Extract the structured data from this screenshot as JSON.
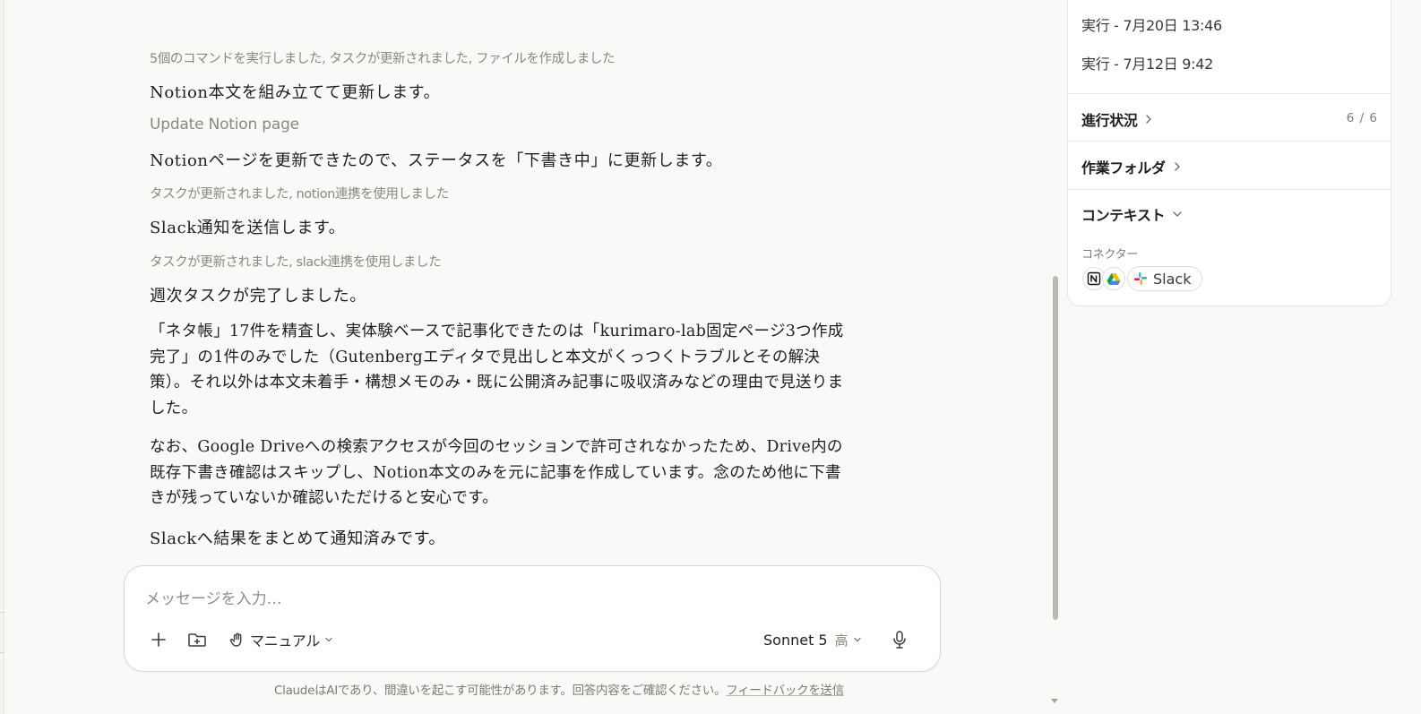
{
  "chat": {
    "tool_summary_1": "5個のコマンドを実行しました, タスクが更新されました, ファイルを作成しました",
    "msg_1": "Notion本文を組み立てて更新します。",
    "action_label": "Update Notion page",
    "msg_2": "Notionページを更新できたので、ステータスを「下書き中」に更新します。",
    "tool_summary_2": "タスクが更新されました, notion連携を使用しました",
    "msg_3": "Slack通知を送信します。",
    "tool_summary_3": "タスクが更新されました, slack連携を使用しました",
    "msg_4": "週次タスクが完了しました。",
    "para_1": [
      "「ネタ帳」17件を精査し、実体験ベースで記事化できたのは「kurimaro-lab固定ページ3つ作成",
      "完了」の1件のみでした（Gutenbergエディタで見出しと本文がくっつくトラブルとその解決",
      "策）。それ以外は本文未着手・構想メモのみ・既に公開済み記事に吸収済みなどの理由で見送りま",
      "した。"
    ],
    "para_2": [
      "なお、Google Driveへの検索アクセスが今回のセッションで許可されなかったため、Drive内の",
      "既存下書き確認はスキップし、Notion本文のみを元に記事を作成しています。念のため他に下書",
      "きが残っていないか確認いただけると安心です。"
    ],
    "msg_5": "Slackへ結果をまとめて通知済みです。"
  },
  "composer": {
    "placeholder": "メッセージを入力…",
    "mode_label": "マニュアル",
    "model_name": "Sonnet 5",
    "model_effort": "高"
  },
  "footer": {
    "disclaimer": "ClaudeはAIであり、間違いを起こす可能性があります。回答内容をご確認ください。",
    "feedback_link": "フィードバックを送信"
  },
  "panel": {
    "runs": [
      "実行 - 7月20日 13:46",
      "実行 - 7月12日 9:42"
    ],
    "progress_label": "進行状況",
    "progress_count": "6 / 6",
    "folder_label": "作業フォルダ",
    "context_label": "コンテキスト",
    "connector_label": "コネクター",
    "slack_label": "Slack"
  },
  "colors": {
    "background": "#faf9f7",
    "panel": "#ffffff",
    "muted_text": "#8a8883"
  }
}
